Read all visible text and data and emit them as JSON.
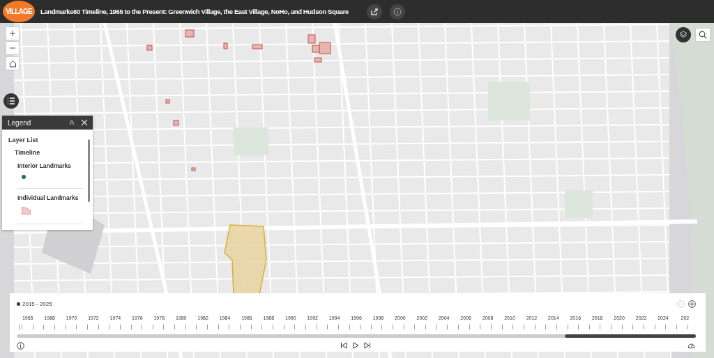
{
  "header": {
    "logo": "VILLAGE",
    "title": "Landmarks60 Timeline, 1965 to the Present: Greenwich Village, the East Village, NoHo, and Hudson Square"
  },
  "legend": {
    "title": "Legend",
    "items": [
      {
        "label": "Layer List",
        "kind": "heading"
      },
      {
        "label": "Timeline",
        "kind": "group"
      },
      {
        "label": "Interior Landmarks",
        "kind": "point",
        "color": "#1c6f7a"
      },
      {
        "label": "Individual Landmarks",
        "kind": "polygon",
        "color": "#f2c8c4"
      }
    ]
  },
  "time_slider": {
    "current": "2015 - 2025",
    "zoom_out_disabled": true,
    "ticks": [
      {
        "label": "1965",
        "in_range": false
      },
      {
        "label": "1968",
        "in_range": false
      },
      {
        "label": "1970",
        "in_range": false
      },
      {
        "label": "1972",
        "in_range": false
      },
      {
        "label": "1974",
        "in_range": false
      },
      {
        "label": "1976",
        "in_range": false
      },
      {
        "label": "1978",
        "in_range": false
      },
      {
        "label": "1980",
        "in_range": false
      },
      {
        "label": "1982",
        "in_range": false
      },
      {
        "label": "1984",
        "in_range": false
      },
      {
        "label": "1986",
        "in_range": false
      },
      {
        "label": "1988",
        "in_range": false
      },
      {
        "label": "1990",
        "in_range": false
      },
      {
        "label": "1992",
        "in_range": false
      },
      {
        "label": "1994",
        "in_range": false
      },
      {
        "label": "1996",
        "in_range": false
      },
      {
        "label": "1998",
        "in_range": false
      },
      {
        "label": "2000",
        "in_range": false
      },
      {
        "label": "2002",
        "in_range": false
      },
      {
        "label": "2004",
        "in_range": false
      },
      {
        "label": "2006",
        "in_range": false
      },
      {
        "label": "2008",
        "in_range": false
      },
      {
        "label": "2010",
        "in_range": false
      },
      {
        "label": "2012",
        "in_range": false
      },
      {
        "label": "2014",
        "in_range": false
      },
      {
        "label": "2016",
        "in_range": true
      },
      {
        "label": "2018",
        "in_range": true
      },
      {
        "label": "2020",
        "in_range": true
      },
      {
        "label": "2022",
        "in_range": true
      },
      {
        "label": "2024",
        "in_range": true
      },
      {
        "label": "202",
        "in_range": true
      }
    ]
  }
}
